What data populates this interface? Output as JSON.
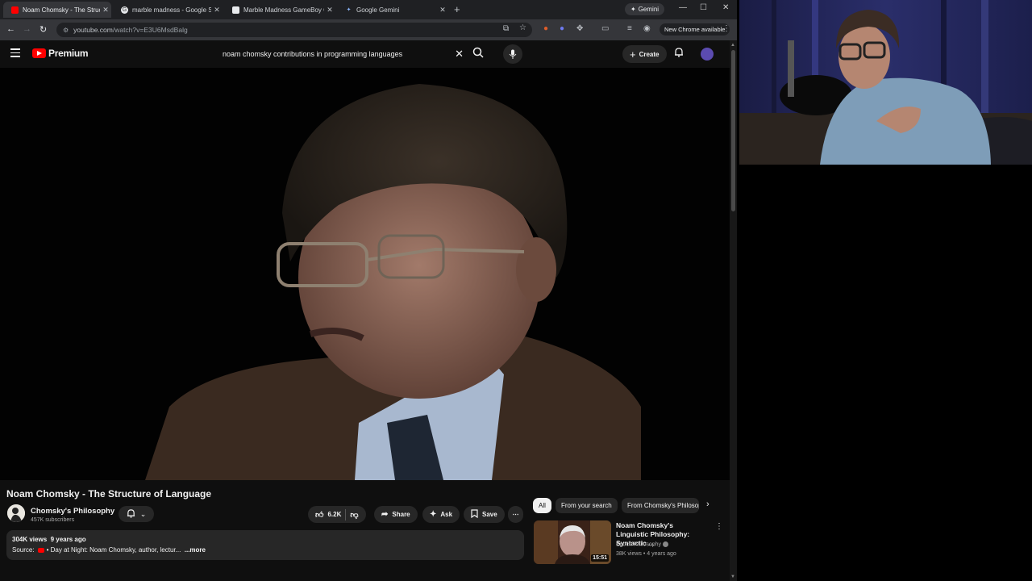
{
  "browser": {
    "tabs": [
      {
        "title": "Noam Chomsky - The Structu",
        "active": true
      },
      {
        "title": "marble madness - Google Sear",
        "active": false
      },
      {
        "title": "Marble Madness GameBoy Col",
        "active": false
      },
      {
        "title": "Google Gemini",
        "active": false
      }
    ],
    "gemini_label": "Gemini",
    "url_host": "youtube.com",
    "url_path": "/watch?v=E3U6MsdBalg",
    "update_label": "New Chrome available"
  },
  "youtube": {
    "logo_text": "Premium",
    "search_query": "noam chomsky contributions in programming languages",
    "create_label": "Create",
    "video": {
      "title": "Noam Chomsky - The Structure of Language",
      "channel": "Chomsky's Philosophy",
      "subscribers": "457K subscribers",
      "likes": "6.2K",
      "share_label": "Share",
      "ask_label": "Ask",
      "save_label": "Save",
      "views": "304K views",
      "age": "9 years ago",
      "source_prefix": "Source:",
      "source_text": "Day at Night: Noam Chomsky, author, lectur...",
      "more_label": "...more"
    },
    "chips": [
      "All",
      "From your search",
      "From Chomsky's Philosophy"
    ],
    "suggestion": {
      "title": "Noam Chomsky's Linguistic Philosophy: Syntactic ...",
      "channel": "Epoch Philosophy",
      "views": "38K views",
      "age": "4 years ago",
      "duration": "15:51"
    }
  }
}
